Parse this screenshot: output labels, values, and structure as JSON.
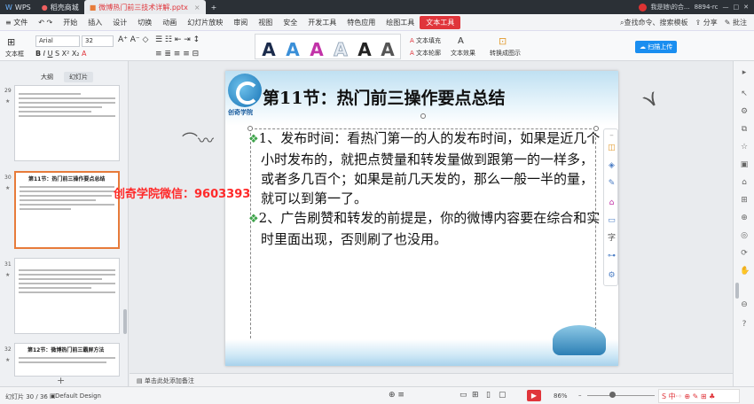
{
  "titlebar": {
    "tabs": [
      {
        "label": "WPS"
      },
      {
        "label": "稻壳商城"
      },
      {
        "label": "微博热门前三技术详解.pptx"
      }
    ],
    "new_tab": "+",
    "right_text": "我是她\\的合...",
    "right_sub": "8894-rc"
  },
  "menubar": {
    "file_menu": "≡ 文件",
    "items": [
      "开始",
      "插入",
      "设计",
      "切换",
      "动画",
      "幻灯片放映",
      "审阅",
      "视图",
      "安全",
      "开发工具",
      "特色应用",
      "绘图工具"
    ],
    "active_tab": "文本工具",
    "search": "查找命令、搜索模板",
    "share": "分享",
    "comment": "批注"
  },
  "ribbon": {
    "textbox": "文本框",
    "font": "Arial",
    "size": "32",
    "text_fill": "文本填充",
    "text_outline": "文本轮廓",
    "text_effect": "文本效果",
    "convert": "转换成图示",
    "cloud": "扫描上传",
    "wordart_colors": [
      "#1b2b4c",
      "#3a8fd8",
      "#c233a8",
      "#e9eef5",
      "#222222",
      "#555555"
    ]
  },
  "leftpanel": {
    "tab_outline": "大纲",
    "tab_slides": "幻灯片",
    "thumbs": [
      {
        "num": "29",
        "title": ""
      },
      {
        "num": "30",
        "title": "第11节：热门前三操作要点总结"
      },
      {
        "num": "31",
        "title": ""
      },
      {
        "num": "32",
        "title": "第12节：微博热门前三霸屏方法"
      }
    ],
    "add": "+"
  },
  "slide": {
    "logo_text": "创奇学院",
    "title": "第11节：热门前三操作要点总结",
    "bullets": [
      "1、发布时间：看热门第一的人的发布时间，如果是近几个小时发布的，就把点赞量和转发量做到跟第一的一样多，或者多几百个；如果是前几天发的，那么一般一半的量，就可以到第一了。",
      "2、广告刷赞和转发的前提是，你的微博内容要在综合和实时里面出现，否则刷了也没用。"
    ],
    "bullet_glyph": "❖"
  },
  "watermark": "创奇学院微信：9603393",
  "notes": {
    "placeholder": "单击此处添加备注"
  },
  "statusbar": {
    "slide_counter": "幻灯片 30 / 36",
    "theme": "Default Design",
    "zoom": "86%"
  },
  "accent_color": "#e0353b"
}
